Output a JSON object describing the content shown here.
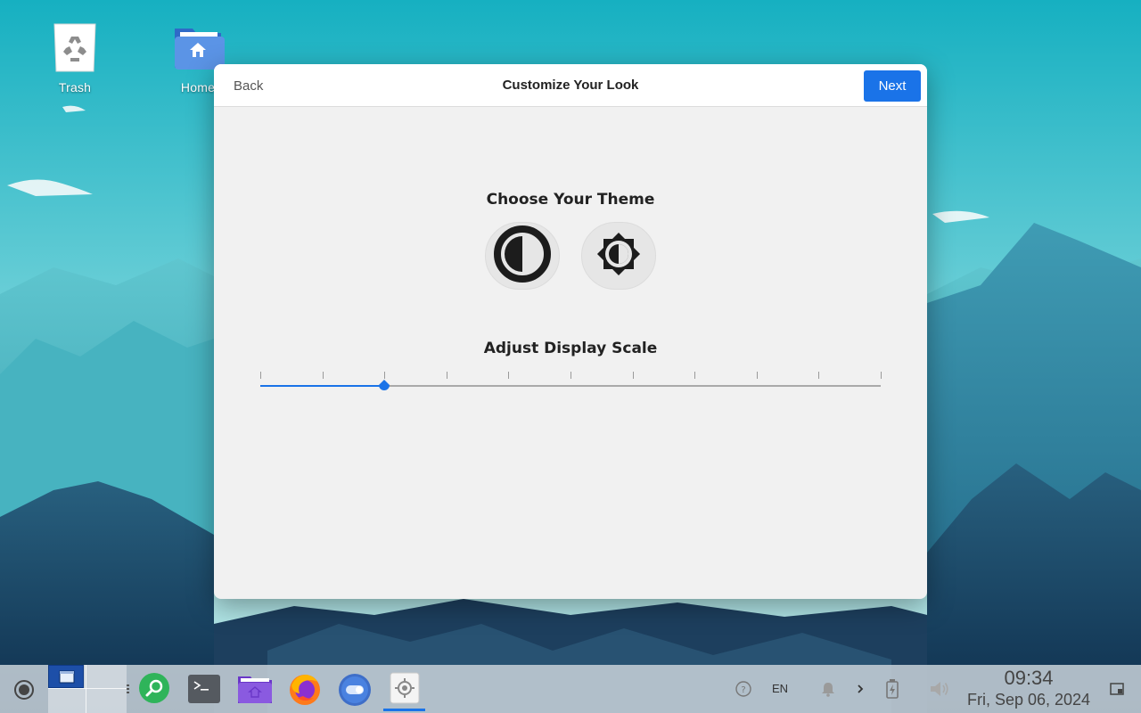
{
  "desktop": {
    "icons": [
      {
        "label": "Trash",
        "icon": "recycle-bin-icon"
      },
      {
        "label": "Home",
        "icon": "home-folder-icon"
      }
    ]
  },
  "dialog": {
    "back_label": "Back",
    "title": "Customize Your Look",
    "next_label": "Next",
    "theme_section": {
      "title": "Choose Your Theme",
      "options": [
        {
          "name": "dark",
          "icon": "dark-contrast-icon"
        },
        {
          "name": "light",
          "icon": "brightness-icon"
        }
      ]
    },
    "scale_section": {
      "title": "Adjust Display Scale",
      "tick_count": 11,
      "selected_index": 2
    }
  },
  "taskbar": {
    "launchers": [
      "show-desktop-icon",
      "workspace-switcher",
      "search-app-icon",
      "terminal-icon",
      "files-icon",
      "firefox-icon",
      "toggle-settings-icon",
      "setup-app-icon"
    ],
    "tray": {
      "help_icon": "help-icon",
      "language": "EN",
      "notifications_icon": "bell-icon",
      "expand_icon": "chevron-right-icon",
      "battery_icon": "battery-charging-icon",
      "volume_icon": "volume-icon",
      "time": "09:34",
      "date": "Fri, Sep 06, 2024",
      "corner_icon": "show-desktop-corner-icon"
    }
  },
  "colors": {
    "accent": "#1a73e8",
    "dialog_bg": "#f1f1f1",
    "header_bg": "#ffffff",
    "sky_top": "#17b1c2",
    "taskbar_bg": "#c4ced6"
  }
}
